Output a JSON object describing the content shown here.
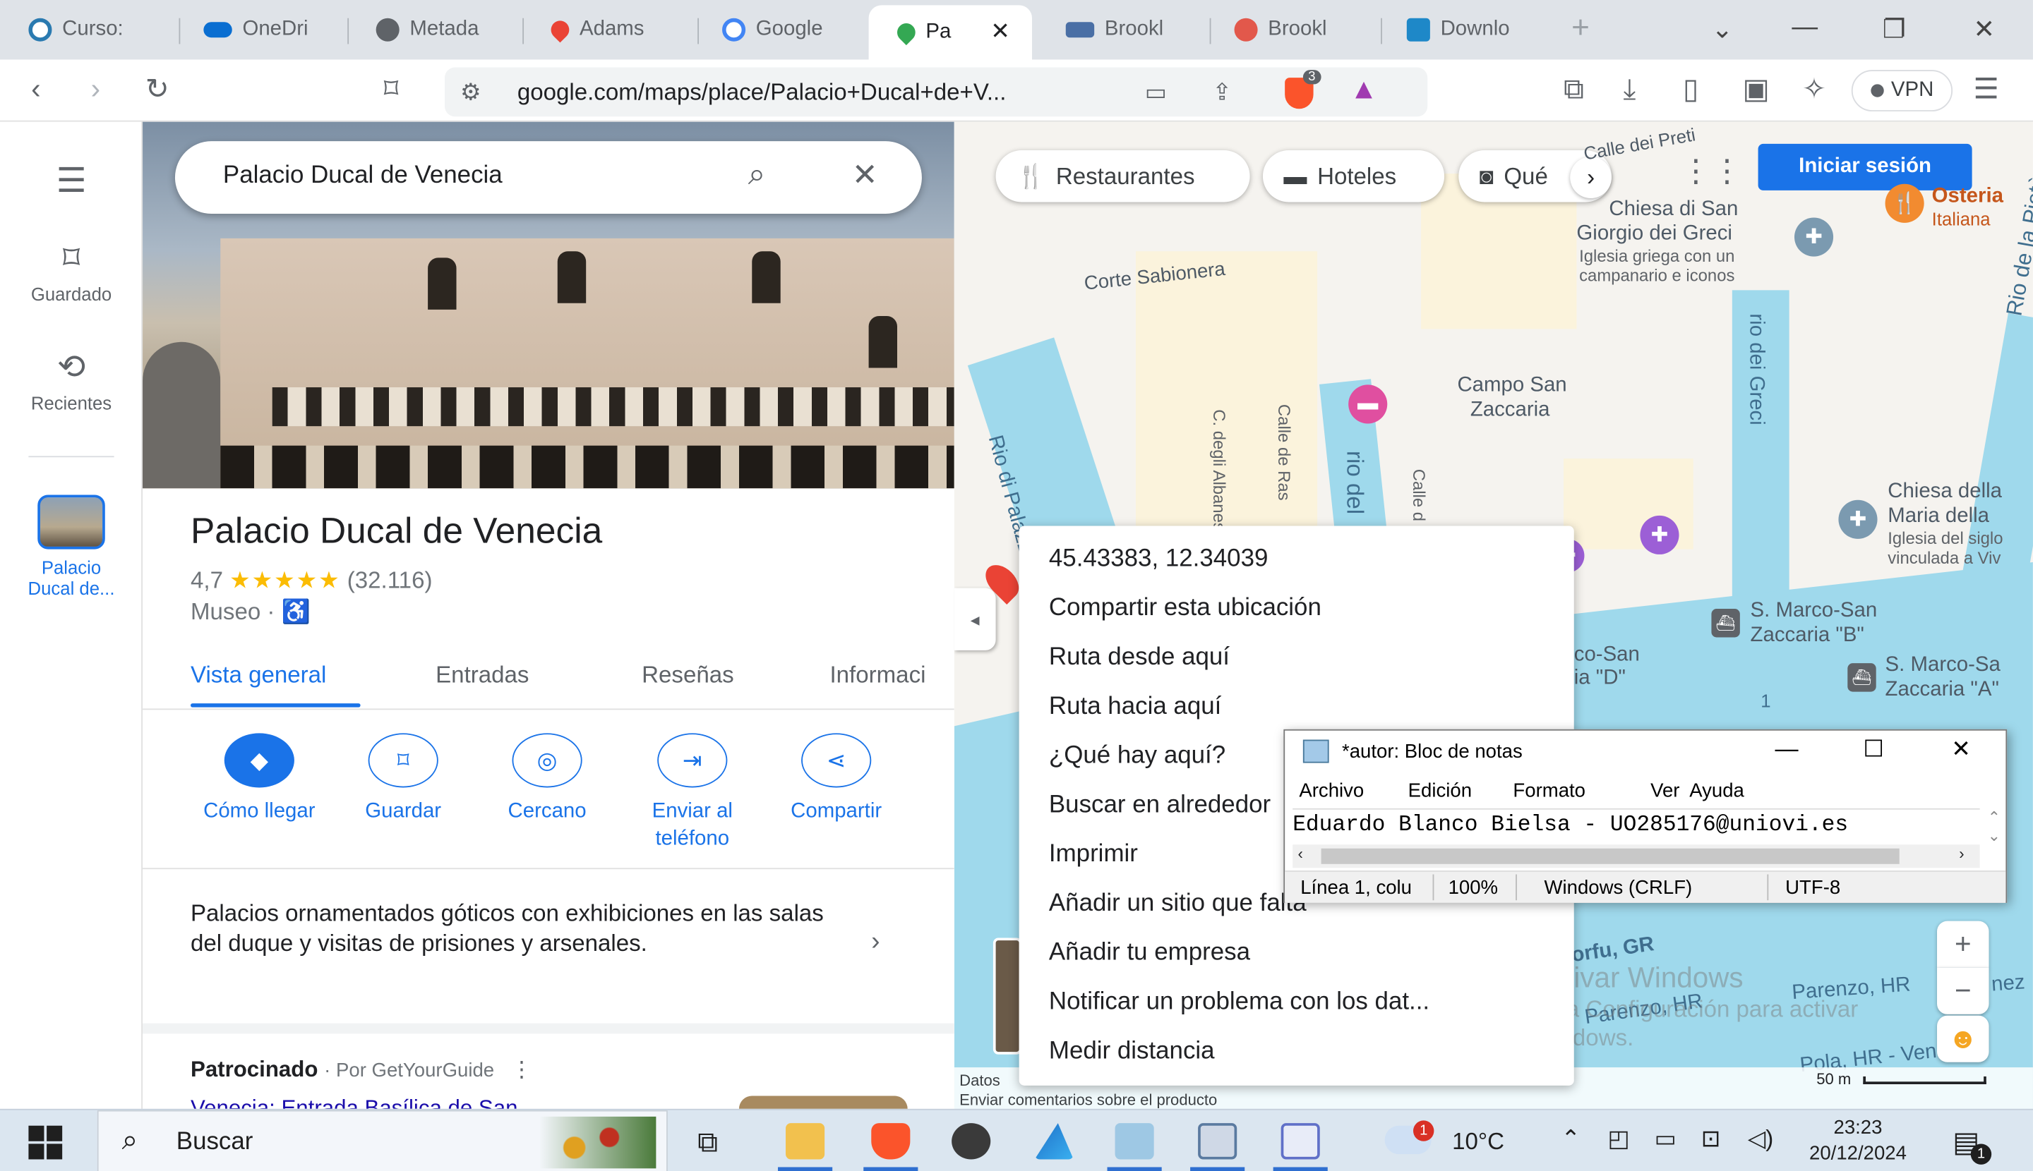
{
  "browser": {
    "tabs": [
      {
        "label": "Curso:"
      },
      {
        "label": "OneDri"
      },
      {
        "label": "Metada"
      },
      {
        "label": "Adams"
      },
      {
        "label": "Google"
      },
      {
        "label": "Pa"
      },
      {
        "label": "Brookl"
      },
      {
        "label": "Brookl"
      },
      {
        "label": "Downlo"
      }
    ],
    "new_tab_icon": "+",
    "url": "google.com/maps/place/Palacio+Ducal+de+V...",
    "vpn_label": "VPN",
    "brave_badge": "3"
  },
  "rail": {
    "saved_label": "Guardado",
    "recent_label": "Recientes",
    "place_label_line1": "Palacio",
    "place_label_line2": "Ducal de..."
  },
  "panel": {
    "search_value": "Palacio Ducal de Venecia",
    "title": "Palacio Ducal de Venecia",
    "rating": "4,7",
    "stars": "★★★★★",
    "review_count": "(32.116)",
    "category": "Museo ·",
    "tabs": [
      "Vista general",
      "Entradas",
      "Reseñas",
      "Informaci"
    ],
    "actions": [
      {
        "label": "Cómo llegar",
        "icon": "directions-icon"
      },
      {
        "label": "Guardar",
        "icon": "bookmark-icon"
      },
      {
        "label": "Cercano",
        "icon": "nearby-icon"
      },
      {
        "label": "Enviar al teléfono",
        "icon": "send-to-phone-icon"
      },
      {
        "label": "Compartir",
        "icon": "share-icon"
      }
    ],
    "description": "Palacios ornamentados góticos con exhibiciones en las salas del duque y visitas de prisiones y arsenales.",
    "sponsored_label": "Patrocinado",
    "sponsored_by": "Por GetYourGuide",
    "sponsored_link": "Venecia: Entrada Basílica de San"
  },
  "map": {
    "chips": [
      {
        "label": "Restaurantes",
        "icon": "fork-knife-icon"
      },
      {
        "label": "Hoteles",
        "icon": "bed-icon"
      },
      {
        "label": "Qué",
        "icon": "camera-icon"
      }
    ],
    "signin_label": "Iniciar sesión",
    "labels": {
      "calle_dei_preti": "Calle dei Preti",
      "chiesa_san_giorgio_1": "Chiesa di San",
      "chiesa_san_giorgio_2": "Giorgio dei Greci",
      "chiesa_san_giorgio_sub1": "Iglesia griega con un",
      "chiesa_san_giorgio_sub2": "campanario e iconos",
      "osteria_1": "Osteria",
      "osteria_2": "Italiana",
      "corte_sabionera": "Corte Sabionera",
      "rio_di_palazzo": "Rio di Palazzo",
      "rio_dei_greci": "rio dei Greci",
      "rio_della_pieta": "Rio de la Pietà",
      "campo_san_zaccaria_1": "Campo San",
      "campo_san_zaccaria_2": "Zaccaria",
      "c_degli_albanesi": "C. degli Albanesi",
      "calle_de_ras": "Calle de Ras",
      "rio_del": "rio del",
      "calle_d": "Calle d",
      "chiesa_della_1": "Chiesa della",
      "chiesa_della_2": "Maria della",
      "chiesa_della_sub1": "Iglesia del siglo",
      "chiesa_della_sub2": "vinculada a Viv",
      "marco_b_1": "S. Marco-San",
      "marco_b_2": "Zaccaria \"B\"",
      "marco_a_1": "S. Marco-Sa",
      "marco_a_2": "Zaccaria \"A\"",
      "zaccaria_d_1": "co-San",
      "zaccaria_d_2": "ia \"D\"",
      "corfu": "orfu, GR",
      "parenzo_1": "Parenzo, HR",
      "parenzo_2": "Parenzo, HR",
      "pola": "Pola, HR - Venezia,",
      "num_one": "1",
      "nez": "nez"
    },
    "attribution": "Datos",
    "feedback": "Enviar comentarios sobre el producto",
    "scale": "50 m",
    "watermark_title": "Activar Windows",
    "watermark_sub1": "Ve a Configuración para activar",
    "watermark_sub2": "Windows."
  },
  "context_menu": {
    "items": [
      "45.43383, 12.34039",
      "Compartir esta ubicación",
      "Ruta desde aquí",
      "Ruta hacia aquí",
      "¿Qué hay aquí?",
      "Buscar en alrededor",
      "Imprimir",
      "Añadir un sitio que falta",
      "Añadir tu empresa",
      "Notificar un problema con los dat...",
      "Medir distancia"
    ]
  },
  "notepad": {
    "title": "*autor: Bloc de notas",
    "menu": [
      "Archivo",
      "Edición",
      "Formato",
      "Ver",
      "Ayuda"
    ],
    "content": "Eduardo Blanco Bielsa - UO285176@uniovi.es",
    "status_line": "Línea 1, colu",
    "status_zoom": "100%",
    "status_eol": "Windows (CRLF)",
    "status_enc": "UTF-8"
  },
  "taskbar": {
    "search_label": "Buscar",
    "weather": "10°C",
    "weather_badge": "1",
    "time": "23:23",
    "date": "20/12/2024",
    "notif_badge": "1"
  },
  "colors": {
    "accent": "#1a73e8",
    "water": "#9fd9ec",
    "brave": "#fb542b"
  }
}
